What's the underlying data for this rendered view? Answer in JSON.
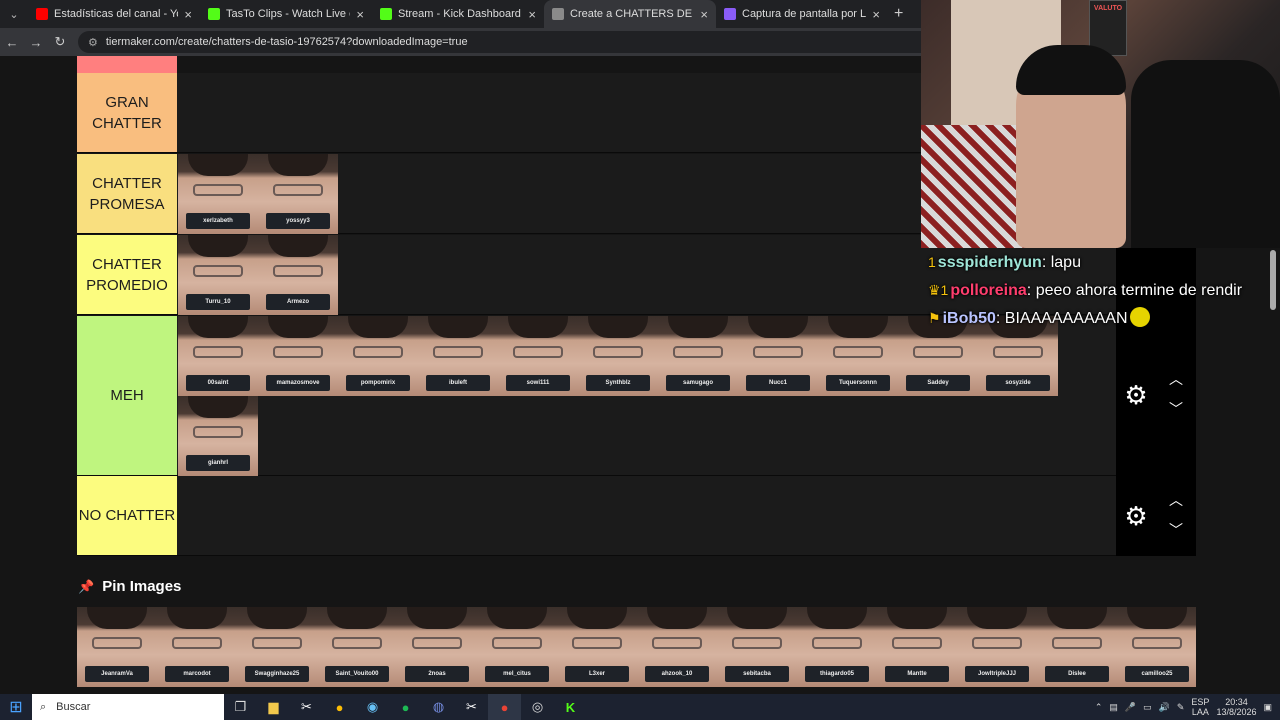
{
  "browser": {
    "tabs": [
      {
        "title": "Estadísticas del canal - YouTube",
        "color": "#ff0000",
        "active": false
      },
      {
        "title": "TasTo Clips - Watch Live on Kick",
        "color": "#53fc18",
        "active": false
      },
      {
        "title": "Stream - Kick Dashboard",
        "color": "#53fc18",
        "active": false
      },
      {
        "title": "Create a CHATTERS DE TASIO T",
        "color": "#8a8a8a",
        "active": true
      },
      {
        "title": "Captura de pantalla por Lightsh",
        "color": "#8a5cf6",
        "active": false
      }
    ],
    "url": "tiermaker.com/create/chatters-de-tasio-19762574?downloadedImage=true"
  },
  "tiers": [
    {
      "label": "GRAN CHATTER",
      "color": "#f9be7f",
      "items": []
    },
    {
      "label": "CHATTER PROMESA",
      "color": "#f9df7f",
      "items": [
        "xerlzabeth",
        "yossyy3"
      ]
    },
    {
      "label": "CHATTER PROMEDIO",
      "color": "#fcfc7f",
      "items": [
        "Turru_10",
        "Armezo"
      ]
    },
    {
      "label": "MEH",
      "color": "#bff57f",
      "items": [
        "00saint",
        "mamazosmove",
        "pompomirix",
        "ibuleft",
        "sowi111",
        "Synthblz",
        "samugago",
        "Nucc1",
        "Tuquersonnn",
        "Saddey",
        "sosyzide",
        "gianhrl"
      ]
    },
    {
      "label": "NO CHATTER",
      "color": "#fcfc7f",
      "items": []
    }
  ],
  "pin_section": {
    "title": "Pin Images",
    "items": [
      "JeanramVa",
      "marcodot",
      "Swagginhaze25",
      "Saint_Vouito00",
      "2noas",
      "mel_citus",
      "L3xer",
      "ahzook_10",
      "sebitacba",
      "thiagardo05",
      "Mantte",
      "JowltripleJJJ",
      "Dislee",
      "camilloo25"
    ]
  },
  "stream": {
    "poster_text": "VALUTO",
    "chat": [
      {
        "user": "ssspiderhyun",
        "text": ": lapu",
        "badges": "1",
        "style": "u1"
      },
      {
        "user": "polloreina",
        "text": ": peeo ahora termine de rendir",
        "badges": "♛1",
        "style": "u2"
      },
      {
        "user": "iBob50",
        "text": ": BIAAAAAAAAAN",
        "badges": "⚑",
        "style": "u3"
      }
    ]
  },
  "taskbar": {
    "search_placeholder": "Buscar",
    "lang_line1": "ESP",
    "lang_line2": "LAA",
    "time": "20:34",
    "date": "13/8/2026"
  }
}
